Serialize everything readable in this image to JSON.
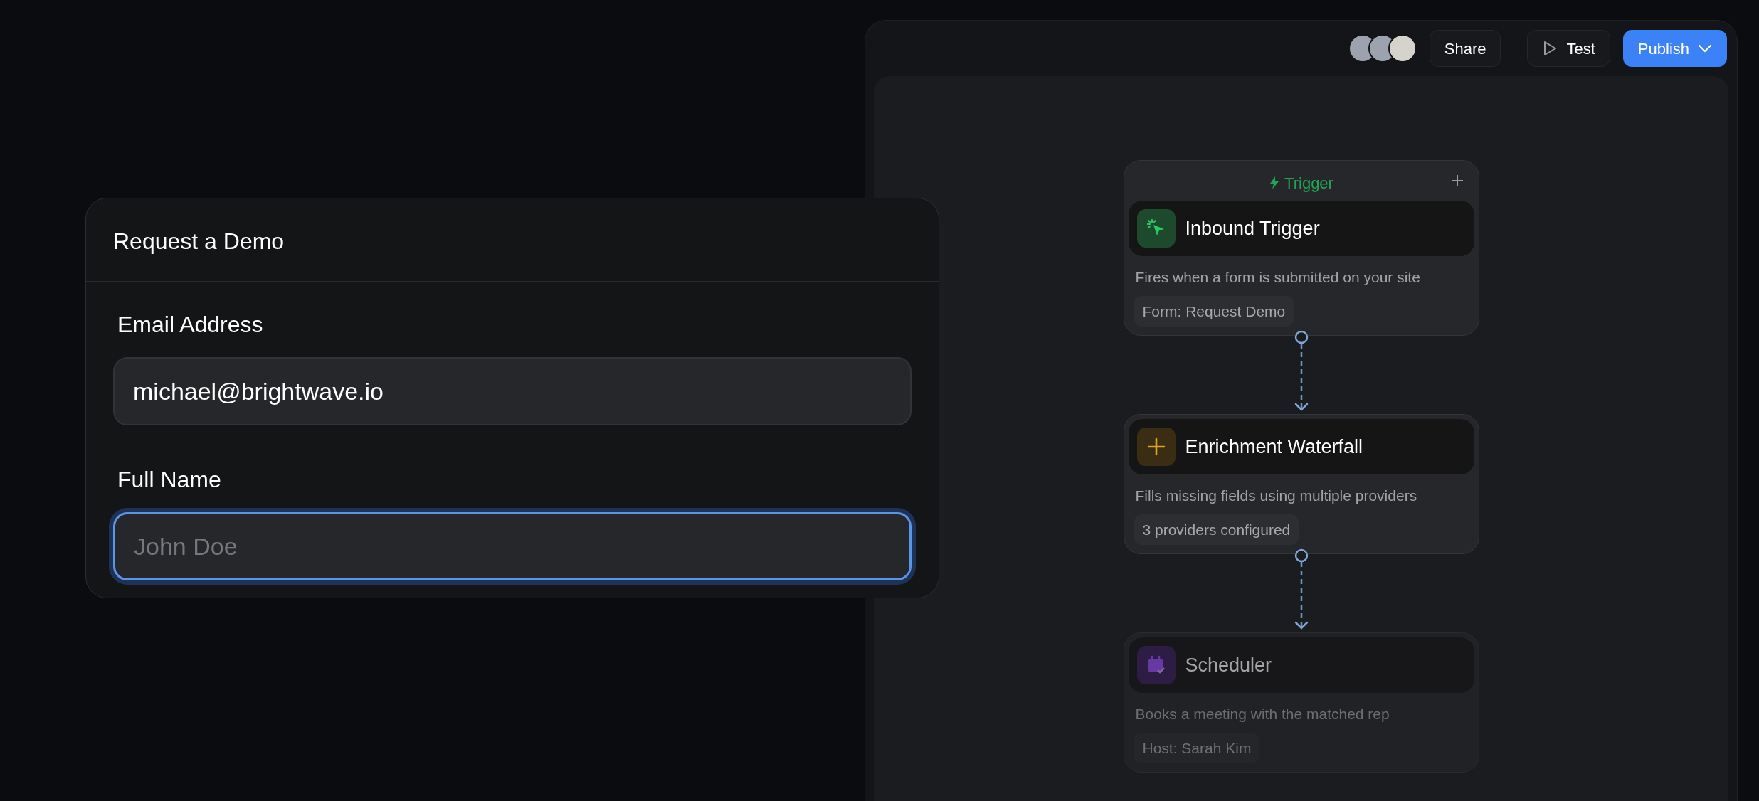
{
  "form": {
    "title": "Request a Demo",
    "fields": [
      {
        "label": "Email Address",
        "value": "michael@brightwave.io",
        "focused": false
      },
      {
        "label": "Full Name",
        "placeholder": "John Doe",
        "focused": true
      }
    ]
  },
  "toolbar": {
    "collaborators": [
      {
        "kind": "person"
      },
      {
        "kind": "person"
      },
      {
        "kind": "pet"
      }
    ],
    "buttons": [
      {
        "label": "Share",
        "kind": "plain"
      },
      {
        "label": "Test",
        "kind": "run"
      },
      {
        "label": "Publish",
        "kind": "primary"
      }
    ]
  },
  "flow": {
    "nodes": [
      {
        "kind": "trigger",
        "section": "Trigger",
        "title": "Inbound Trigger",
        "description": "Fires when a form is submitted on your site",
        "chip": "Form: Request Demo",
        "dimmed": false
      },
      {
        "kind": "enrichment",
        "title": "Enrichment Waterfall",
        "description": "Fills missing fields using multiple providers",
        "chip": "3 providers configured",
        "dimmed": false
      },
      {
        "kind": "scheduler",
        "title": "Scheduler",
        "description": "Books a meeting with the matched rep",
        "chip": "Host: Sarah Kim",
        "dimmed": true
      }
    ]
  }
}
